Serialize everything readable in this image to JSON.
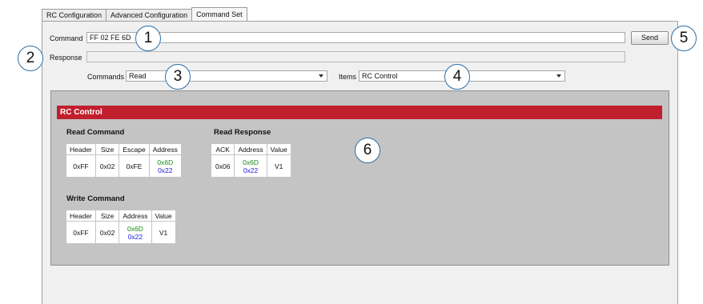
{
  "tabs": [
    {
      "label": "RC Configuration",
      "active": false
    },
    {
      "label": "Advanced Configuration",
      "active": false
    },
    {
      "label": "Command Set",
      "active": true
    }
  ],
  "form": {
    "command_label": "Command",
    "command_value": "FF 02 FE 6D",
    "send_label": "Send",
    "response_label": "Response",
    "response_value": "",
    "commands_label": "Commands",
    "commands_selected": "Read",
    "items_label": "Items",
    "items_selected": "RC Control"
  },
  "callouts": [
    "1",
    "2",
    "3",
    "4",
    "5",
    "6"
  ],
  "section": {
    "title": "RC Control",
    "read_command": {
      "title": "Read Command",
      "headers": [
        "Header",
        "Size",
        "Escape",
        "Address"
      ],
      "row": [
        "0xFF",
        "0x02",
        "0xFE"
      ],
      "address": [
        "0x6D",
        "0x22"
      ]
    },
    "read_response": {
      "title": "Read Response",
      "headers": [
        "ACK",
        "Address",
        "Value"
      ],
      "row_ack": "0x06",
      "address": [
        "0x6D",
        "0x22"
      ],
      "value": "V1"
    },
    "write_command": {
      "title": "Write Command",
      "headers": [
        "Header",
        "Size",
        "Address",
        "Value"
      ],
      "row": [
        "0xFF",
        "0x02"
      ],
      "address": [
        "0x6D",
        "0x22"
      ],
      "value": "V1"
    }
  },
  "colors": {
    "section_bar": "#c11f2d",
    "callout_ring": "#2d6fa6",
    "address_high": "#1a8a1a",
    "address_low": "#1a1adb"
  }
}
